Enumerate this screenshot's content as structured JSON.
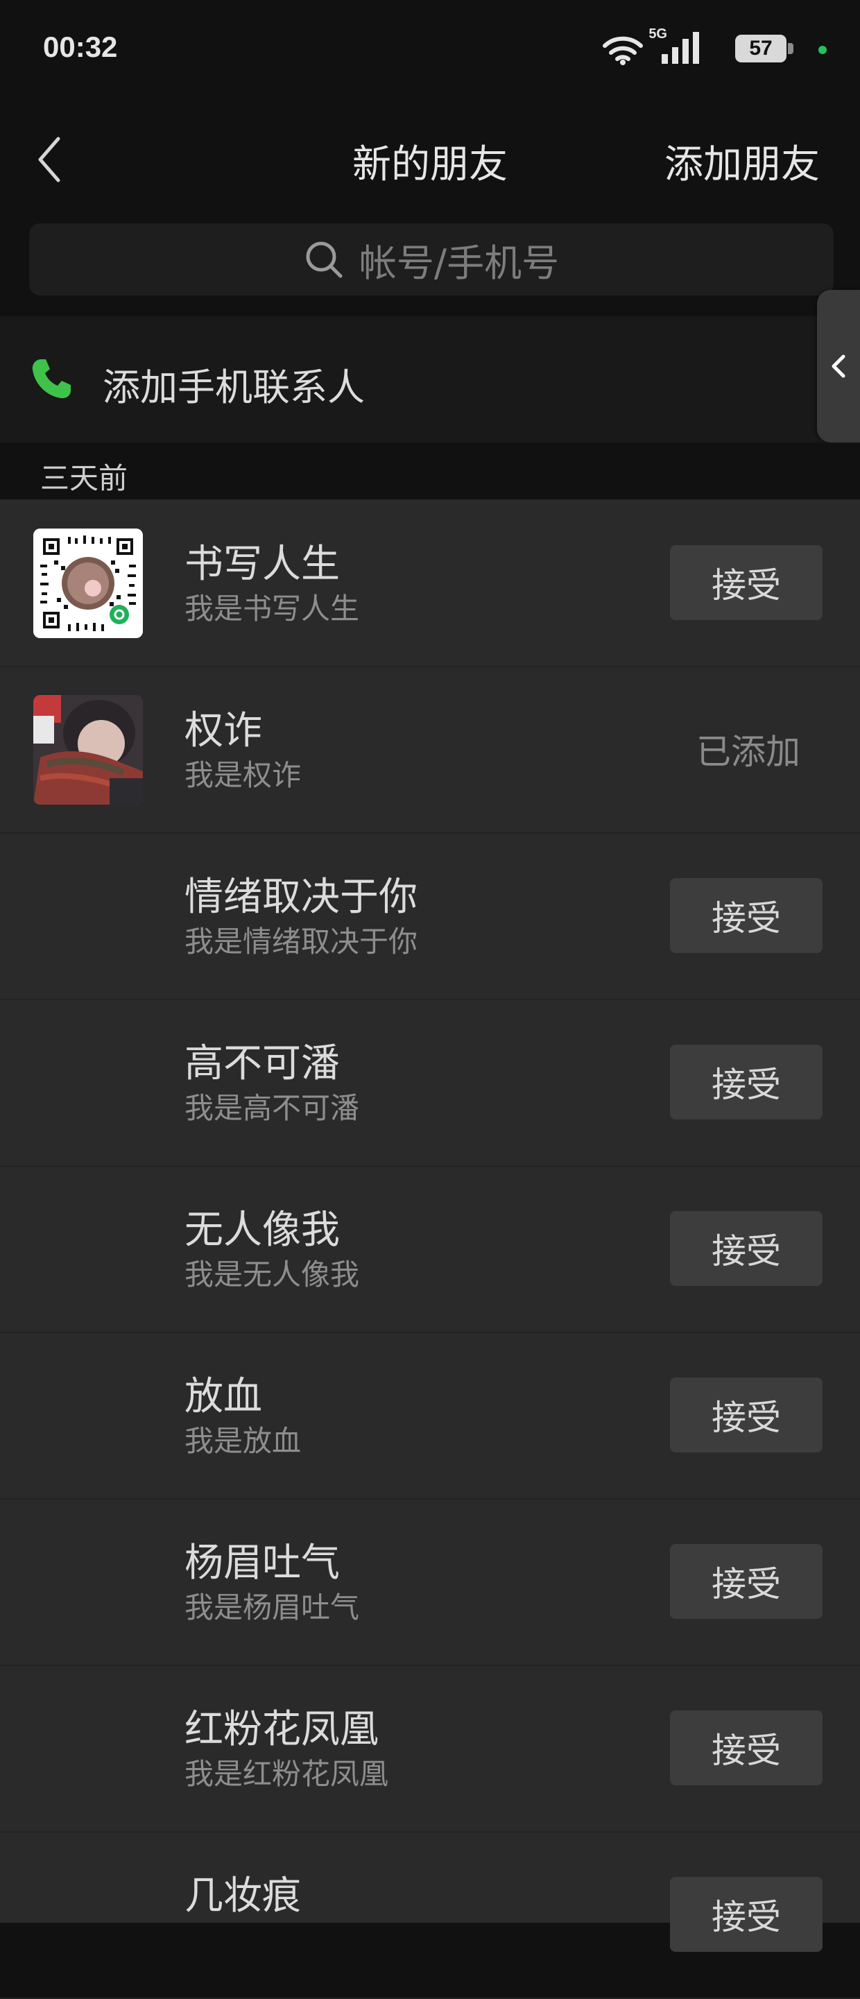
{
  "status_bar": {
    "time": "00:32",
    "network": "5G",
    "battery": "57",
    "dot_color": "#21c25e"
  },
  "nav": {
    "back_icon": "chevron-left-icon",
    "title": "新的朋友",
    "action": "添加朋友"
  },
  "search": {
    "icon": "search-icon",
    "placeholder": "帐号/手机号"
  },
  "phone_contacts": {
    "icon": "phone-icon",
    "label": "添加手机联系人",
    "icon_color": "#3fc24a"
  },
  "section": {
    "label": "三天前"
  },
  "requests": [
    {
      "name": "书写人生",
      "message": "我是书写人生",
      "avatar": "qr-code-avatar",
      "status": "accept",
      "button": "接受"
    },
    {
      "name": "权诈",
      "message": "我是权诈",
      "avatar": "photo-avatar",
      "status": "added",
      "button": "已添加"
    },
    {
      "name": "情绪取决于你",
      "message": "我是情绪取决于你",
      "avatar": "",
      "status": "accept",
      "button": "接受"
    },
    {
      "name": "高不可潘",
      "message": "我是高不可潘",
      "avatar": "",
      "status": "accept",
      "button": "接受"
    },
    {
      "name": "无人像我",
      "message": "我是无人像我",
      "avatar": "",
      "status": "accept",
      "button": "接受"
    },
    {
      "name": "放血",
      "message": "我是放血",
      "avatar": "",
      "status": "accept",
      "button": "接受"
    },
    {
      "name": "杨眉吐气",
      "message": "我是杨眉吐气",
      "avatar": "",
      "status": "accept",
      "button": "接受"
    },
    {
      "name": "红粉花凤凰",
      "message": "我是红粉花凤凰",
      "avatar": "",
      "status": "accept",
      "button": "接受"
    },
    {
      "name": "几妆痕",
      "message": "",
      "avatar": "",
      "status": "accept",
      "button": "接受"
    }
  ]
}
